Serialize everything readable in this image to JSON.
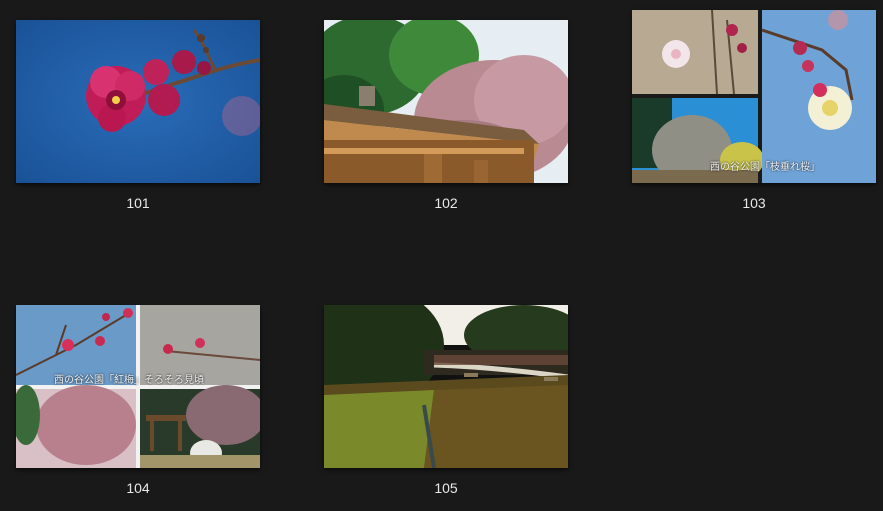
{
  "gallery": {
    "items": [
      {
        "caption": "101"
      },
      {
        "caption": "102"
      },
      {
        "caption": "103",
        "overlay_text": "西の谷公園「枝垂れ桜」"
      },
      {
        "caption": "104",
        "overlay_text": "西の谷公園「紅梅」そろそろ見頃"
      },
      {
        "caption": "105"
      }
    ]
  },
  "colors": {
    "background": "#191919",
    "caption_text": "#e8e8e8",
    "sky_blue": "#1e5fa8",
    "blossom_pink": "#c81e5a"
  }
}
